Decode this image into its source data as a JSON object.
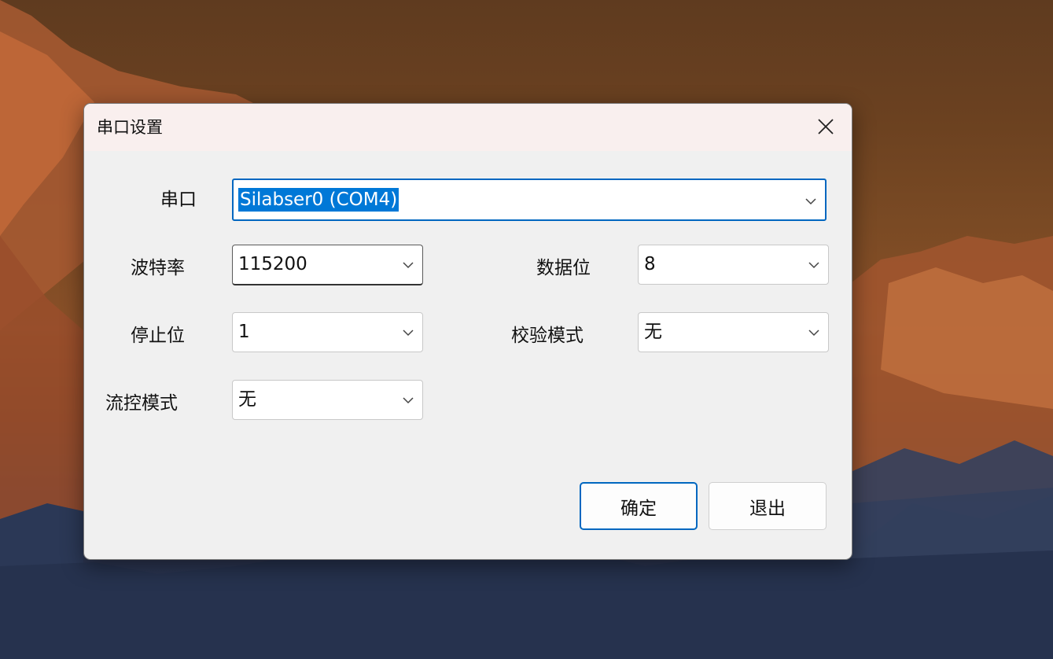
{
  "dialog": {
    "title": "串口设置"
  },
  "fields": {
    "port": {
      "label": "串口",
      "value": "Silabser0 (COM4)"
    },
    "baud_rate": {
      "label": "波特率",
      "value": "115200"
    },
    "data_bits": {
      "label": "数据位",
      "value": "8"
    },
    "stop_bits": {
      "label": "停止位",
      "value": "1"
    },
    "parity": {
      "label": "校验模式",
      "value": "无"
    },
    "flow_control": {
      "label": "流控模式",
      "value": "无"
    }
  },
  "buttons": {
    "ok": "确定",
    "cancel": "退出"
  },
  "icons": {
    "close": "close-icon",
    "dropdown": "chevron-down-icon"
  },
  "colors": {
    "accent": "#0067c0",
    "selection": "#0078d7",
    "titlebar": "#f9efee",
    "dialog_bg": "#f0f0f0"
  }
}
